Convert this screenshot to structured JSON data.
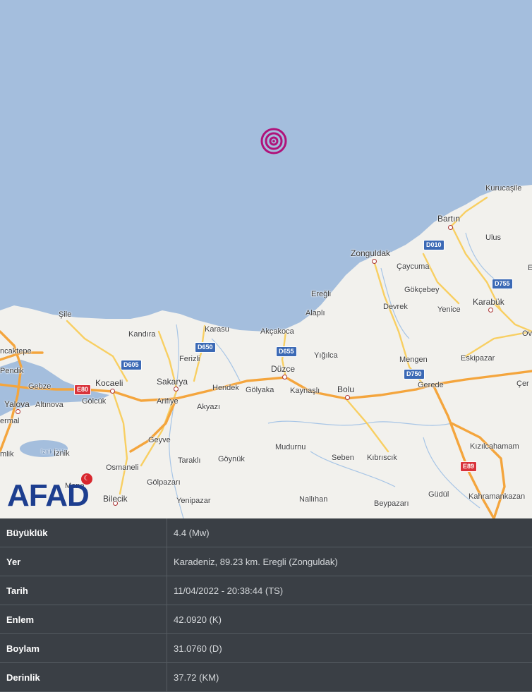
{
  "map": {
    "colors": {
      "sea": "#a4bedd",
      "land": "#f2f1ed",
      "motorway": "#f4a53d",
      "primary": "#f8cf62",
      "river": "#a7c5e6",
      "epicenter": "#b0127a"
    },
    "places": {
      "kurucasile": "Kurucaşile",
      "bartin": "Bartın",
      "ulus": "Ulus",
      "zonguldak": "Zonguldak",
      "caycuma": "Çaycuma",
      "gokcebey": "Gökçebey",
      "karabuk": "Karabük",
      "eregli": "Ereğli",
      "alapli": "Alaplı",
      "devrek": "Devrek",
      "yenice": "Yenice",
      "sile": "Şile",
      "kandira": "Kandıra",
      "karasu": "Karasu",
      "akcakoca": "Akçakoca",
      "cekmekoy": "ncaktepe",
      "pendik": "Pendik",
      "ferizli": "Ferizli",
      "yigilca": "Yığılca",
      "mengen": "Mengen",
      "eskipazar": "Eskipazar",
      "gebze": "Gebze",
      "kocaeli": "Kocaeli",
      "sakarya": "Sakarya",
      "duzce": "Düzce",
      "yalova": "Yalova",
      "altinova": "Altınova",
      "golcuk": "Gölcük",
      "arifiye": "Arifiye",
      "hendek": "Hendek",
      "golyaka": "Gölyaka",
      "kaynasli": "Kaynaşlı",
      "bolu": "Bolu",
      "gerede": "Gerede",
      "akyazi": "Akyazı",
      "ermal": "ermal",
      "geyve": "Geyve",
      "iznik_golu": "İznik Gölü",
      "iznik": "İznik",
      "mudurnu": "Mudurnu",
      "tarakli": "Taraklı",
      "goynuk": "Göynük",
      "seben": "Seben",
      "kibriscik": "Kıbrıscık",
      "kizilcahamam": "Kızılcahamam",
      "osmaneli": "Osmaneli",
      "golpazari": "Gölpazarı",
      "bilecik": "Bilecik",
      "yenipazar": "Yenipazar",
      "nallihan": "Nallıhan",
      "beypazari": "Beypazarı",
      "gudul": "Güdül",
      "kahramankazan": "Kahramankazan",
      "mlik": "mlik",
      "ova": "Ov",
      "cer": "Çer",
      "e_edge": "E",
      "mene": "Mene"
    },
    "roads": {
      "d010": "D010",
      "d755": "D755",
      "d650": "D650",
      "d605": "D605",
      "d655": "D655",
      "d750": "D750",
      "e80": "E80",
      "e89": "E89"
    },
    "logo": {
      "text": "AFAD"
    }
  },
  "details": {
    "rows": [
      {
        "label": "Büyüklük",
        "value": "4.4 (Mw)"
      },
      {
        "label": "Yer",
        "value": "Karadeniz, 89.23 km. Eregli (Zonguldak)"
      },
      {
        "label": "Tarih",
        "value": "11/04/2022 - 20:38:44 (TS)"
      },
      {
        "label": "Enlem",
        "value": "42.0920 (K)"
      },
      {
        "label": "Boylam",
        "value": "31.0760 (D)"
      },
      {
        "label": "Derinlik",
        "value": "37.72 (KM)"
      }
    ]
  }
}
